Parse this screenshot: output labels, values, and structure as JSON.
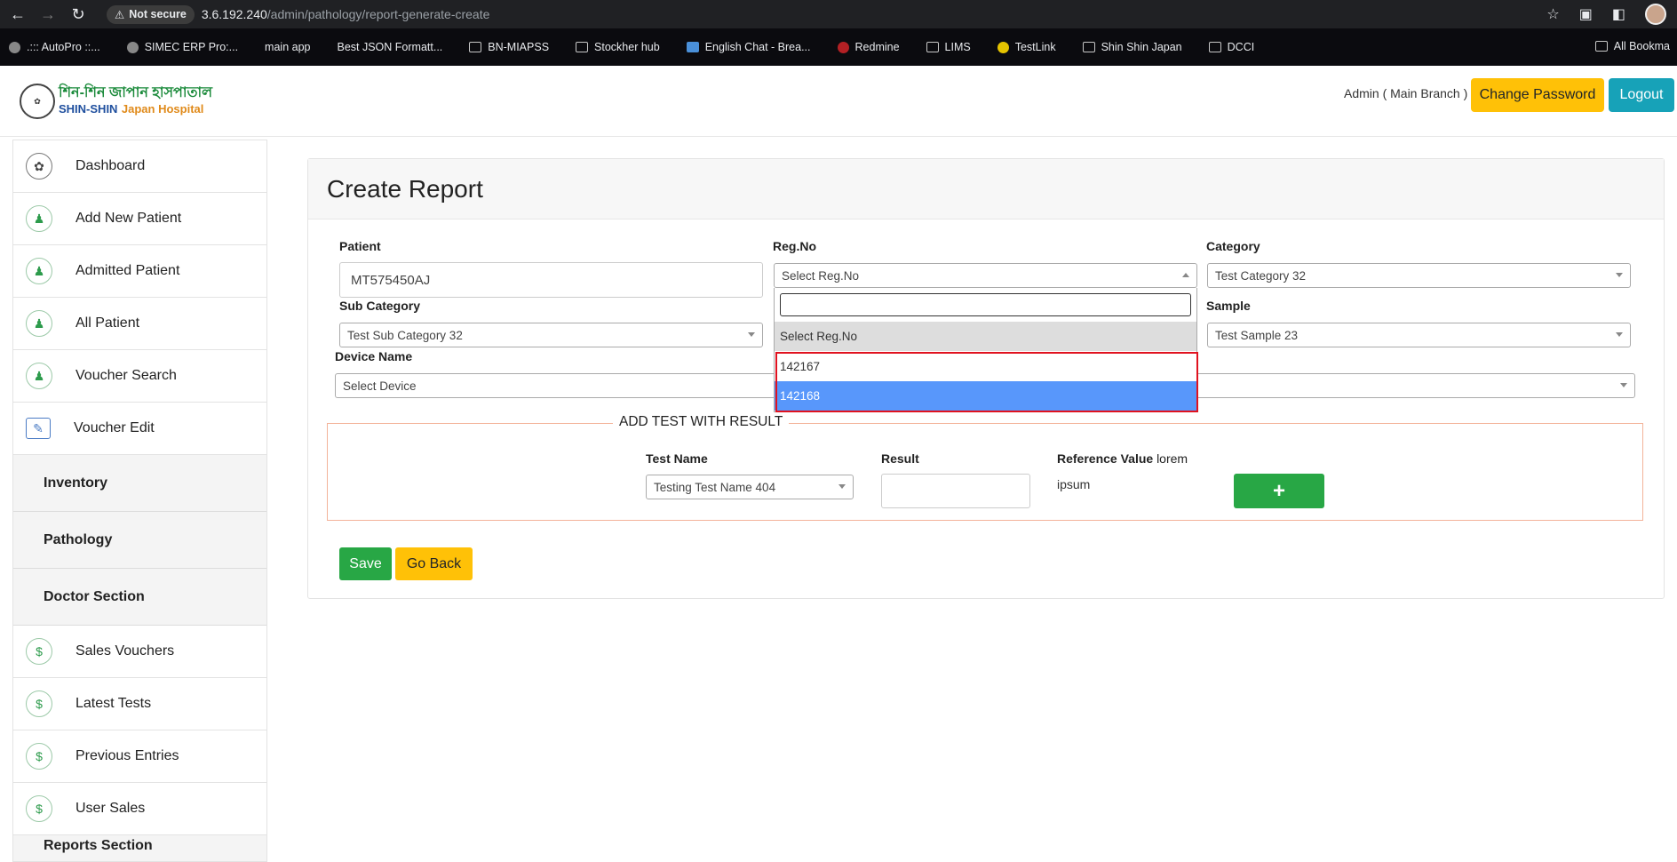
{
  "browser": {
    "not_secure": "Not secure",
    "url_host": "3.6.192.240",
    "url_path": "/admin/pathology/report-generate-create",
    "bookmarks": [
      {
        "label": ".::: AutoPro ::..."
      },
      {
        "label": "SIMEC ERP Pro:..."
      },
      {
        "label": "main app"
      },
      {
        "label": "Best JSON Formatt..."
      },
      {
        "label": "BN-MIAPSS"
      },
      {
        "label": "Stockher hub"
      },
      {
        "label": "English Chat - Brea..."
      },
      {
        "label": "Redmine"
      },
      {
        "label": "LIMS"
      },
      {
        "label": "TestLink"
      },
      {
        "label": "Shin Shin Japan"
      },
      {
        "label": "DCCI"
      }
    ],
    "all_bookmarks": "All Bookma"
  },
  "header": {
    "logo_bn": "শিন-শিন জাপান হাসপাতাল",
    "logo_en1": "SHIN-SHIN",
    "logo_en2": "Japan Hospital",
    "user": "Admin ( Main Branch )",
    "change_password": "Change Password",
    "logout": "Logout"
  },
  "sidebar": {
    "items_top": [
      {
        "label": "Dashboard",
        "icon": "dashboard-icon"
      },
      {
        "label": "Add New Patient",
        "icon": "patient-icon"
      },
      {
        "label": "Admitted Patient",
        "icon": "patient-icon"
      },
      {
        "label": "All Patient",
        "icon": "patient-icon"
      },
      {
        "label": "Voucher Search",
        "icon": "patient-icon"
      },
      {
        "label": "Voucher Edit",
        "icon": "voucher-edit-icon"
      }
    ],
    "sections": [
      "Inventory",
      "Pathology",
      "Doctor Section"
    ],
    "items_bottom": [
      {
        "label": "Sales Vouchers"
      },
      {
        "label": "Latest Tests"
      },
      {
        "label": "Previous Entries"
      },
      {
        "label": "User Sales"
      }
    ],
    "reports_section": "Reports Section"
  },
  "form": {
    "title": "Create Report",
    "patient_label": "Patient",
    "patient_value": "MT575450AJ",
    "regno_label": "Reg.No",
    "regno_value": "Select Reg.No",
    "category_label": "Category",
    "category_value": "Test Category 32",
    "subcategory_label": "Sub Category",
    "subcategory_value": "Test Sub Category 32",
    "sample_label": "Sample",
    "sample_value": "Test Sample 23",
    "device_label": "Device Name",
    "device_value": "Select Device",
    "dropdown": {
      "placeholder": "Select Reg.No",
      "options": [
        "142167",
        "142168"
      ]
    },
    "fieldset_legend": "ADD TEST WITH RESULT",
    "test_name_label": "Test Name",
    "test_name_value": "Testing Test Name 404",
    "result_label": "Result",
    "reference_label": "Reference Value",
    "reference_value_1": "lorem",
    "reference_value_2": "ipsum",
    "add_button": "+",
    "save": "Save",
    "go_back": "Go Back"
  },
  "colors": {
    "success": "#28a745",
    "warning": "#ffc107",
    "info": "#17a2b8",
    "highlight": "#5897fb",
    "annotation": "#e0121f"
  }
}
